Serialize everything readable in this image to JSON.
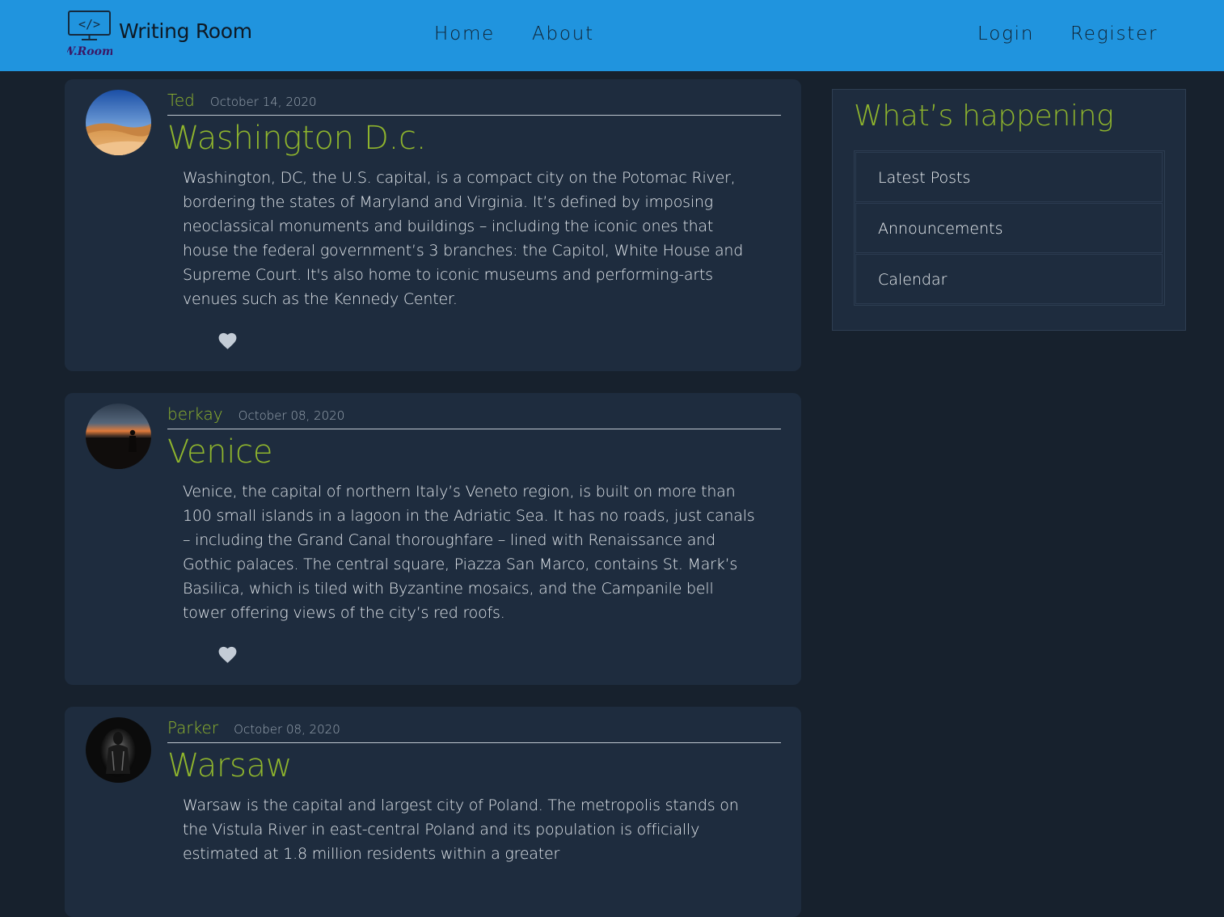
{
  "navbar": {
    "brand_name": "Writing Room",
    "logo": {
      "icon": "code-monitor-icon",
      "text": "W.Room",
      "code_glyph": "</>"
    },
    "links_left": [
      "Home",
      "About"
    ],
    "links_right": [
      "Login",
      "Register"
    ],
    "color": "#2094de"
  },
  "posts": [
    {
      "author": "Ted",
      "date": "October 14, 2020",
      "title": "Washington D.c.",
      "content": "Washington, DC, the U.S. capital, is a compact city on the Potomac River, bordering the states of Maryland and Virginia. It’s defined by imposing neoclassical monuments and buildings – including the iconic ones that house the federal government’s 3 branches: the Capitol, White House and Supreme Court. It's also home to iconic museums and performing-arts venues such as the Kennedy Center.",
      "avatar": "desert-dunes-avatar",
      "like_icon": "heart-icon"
    },
    {
      "author": "berkay",
      "date": "October 08, 2020",
      "title": "Venice",
      "content": "Venice, the capital of northern Italy’s Veneto region, is built on more than 100 small islands in a lagoon in the Adriatic Sea. It has no roads, just canals – including the Grand Canal thoroughfare – lined with Renaissance and Gothic palaces. The central square, Piazza San Marco, contains St. Mark’s Basilica, which is tiled with Byzantine mosaics, and the Campanile bell tower offering views of the city’s red roofs.",
      "avatar": "sunset-silhouette-avatar",
      "like_icon": "heart-icon"
    },
    {
      "author": "Parker",
      "date": "October 08, 2020",
      "title": "Warsaw",
      "content": "Warsaw is the capital and largest city of Poland. The metropolis stands on the Vistula River in east-central Poland and its population is officially estimated at 1.8 million residents within a greater",
      "avatar": "dark-figure-avatar",
      "like_icon": "heart-icon"
    }
  ],
  "sidebar": {
    "heading": "What’s happening",
    "items": [
      "Latest Posts",
      "Announcements",
      "Calendar"
    ]
  },
  "colors": {
    "page_background": "#17212d",
    "card_background": "#1e2c3e",
    "accent_green": "#8fb52d",
    "navbar_blue": "#2094de"
  }
}
